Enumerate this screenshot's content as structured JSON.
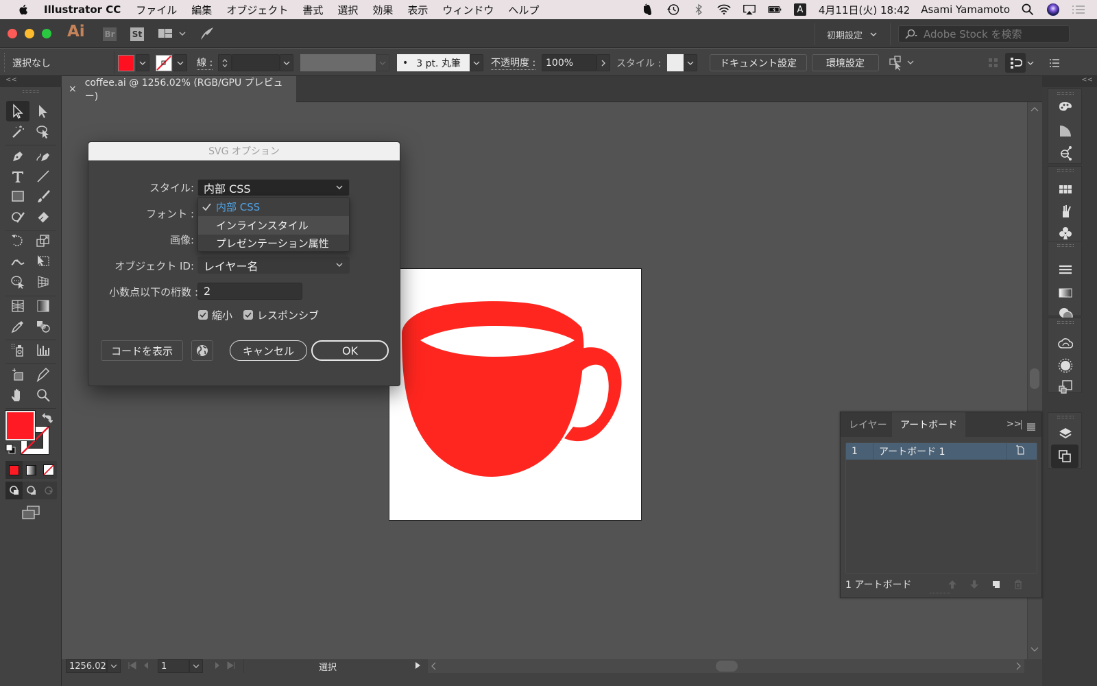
{
  "menubar": {
    "app_name": "Illustrator CC",
    "items": [
      "ファイル",
      "編集",
      "オブジェクト",
      "書式",
      "選択",
      "効果",
      "表示",
      "ウィンドウ",
      "ヘルプ"
    ],
    "status_icons": [
      "evernote-icon",
      "time-machine-icon",
      "bluetooth-icon",
      "wifi-icon",
      "airplay-icon",
      "battery-icon",
      "input-method-icon",
      "spotlight-icon",
      "siri-icon",
      "notification-center-icon"
    ],
    "input_method": "A",
    "clock": "4月11日(火) 18:42",
    "user": "Asami Yamamoto"
  },
  "titlebar": {
    "ai_logo": "Ai",
    "br_logo": "Br",
    "st_logo": "St",
    "workspace": "初期設定",
    "stock_search_placeholder": "Adobe Stock を検索"
  },
  "controlbar": {
    "selection": "選択なし",
    "fill_color": "#ff1020",
    "stroke_label": "線 :",
    "brush": "3 pt. 丸筆",
    "opacity_label": "不透明度 :",
    "opacity_value": "100%",
    "style_label": "スタイル :",
    "document_setup": "ドキュメント設定",
    "preferences": "環境設定"
  },
  "document": {
    "tab_title": "coffee.ai @ 1256.02% (RGB/GPU プレビュー)",
    "close": "×"
  },
  "artwork": {
    "cup_color": "#ff261f",
    "artboard_color": "#ffffff"
  },
  "dialog": {
    "title": "SVG オプション",
    "style_label": "スタイル:",
    "style_value": "内部 CSS",
    "style_options": [
      {
        "label": "内部 CSS",
        "checked": true
      },
      {
        "label": "インラインスタイル",
        "checked": false
      },
      {
        "label": "プレゼンテーション属性",
        "checked": false
      }
    ],
    "font_label": "フォント :",
    "image_label": "画像:",
    "object_id_label": "オブジェクト ID:",
    "object_id_value": "レイヤー名",
    "decimal_label": "小数点以下の桁数 :",
    "decimal_value": "2",
    "minify_label": "縮小",
    "minify_checked": true,
    "responsive_label": "レスポンシブ",
    "responsive_checked": true,
    "show_code": "コードを表示",
    "cancel": "キャンセル",
    "ok": "OK"
  },
  "artboards_panel": {
    "tabs": [
      "レイヤー",
      "アートボード"
    ],
    "active_tab": "アートボード",
    "more": ">>",
    "rows": [
      {
        "index": "1",
        "name": "アートボード 1"
      }
    ],
    "footer_count": "1 アートボード"
  },
  "statusbar": {
    "zoom": "1256.02%",
    "artboard_number": "1",
    "mode": "選択"
  }
}
